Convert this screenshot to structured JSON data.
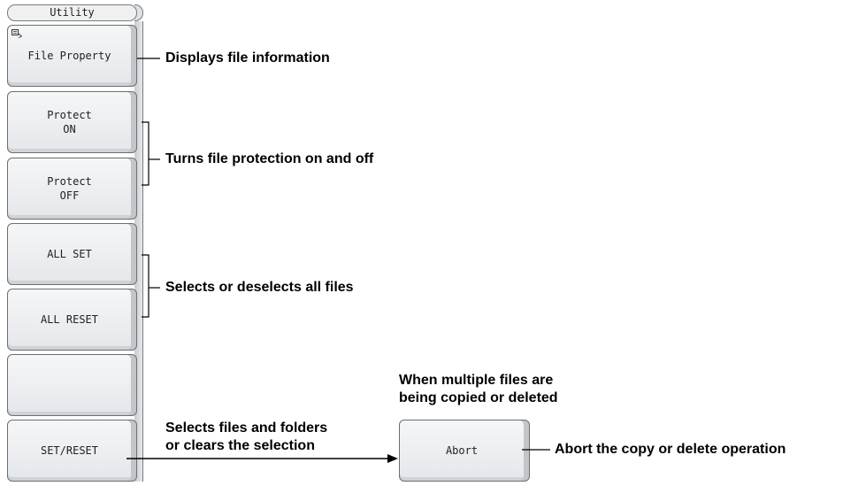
{
  "menu": {
    "title": "Utility",
    "keys": [
      {
        "label": "File Property"
      },
      {
        "label": "Protect\nON"
      },
      {
        "label": "Protect\nOFF"
      },
      {
        "label": "ALL SET"
      },
      {
        "label": "ALL RESET"
      },
      {
        "label": ""
      },
      {
        "label": "SET/RESET"
      }
    ]
  },
  "abort": {
    "label": "Abort"
  },
  "callouts": {
    "file_property": "Displays file information",
    "protect": "Turns file protection on and off",
    "all_set_reset": "Selects or deselects all files",
    "set_reset": "Selects files and folders\nor clears the selection",
    "abort_context": "When multiple files are\nbeing copied or deleted",
    "abort": "Abort the copy or delete operation"
  },
  "icons": {
    "file_property": "file-info-icon"
  }
}
